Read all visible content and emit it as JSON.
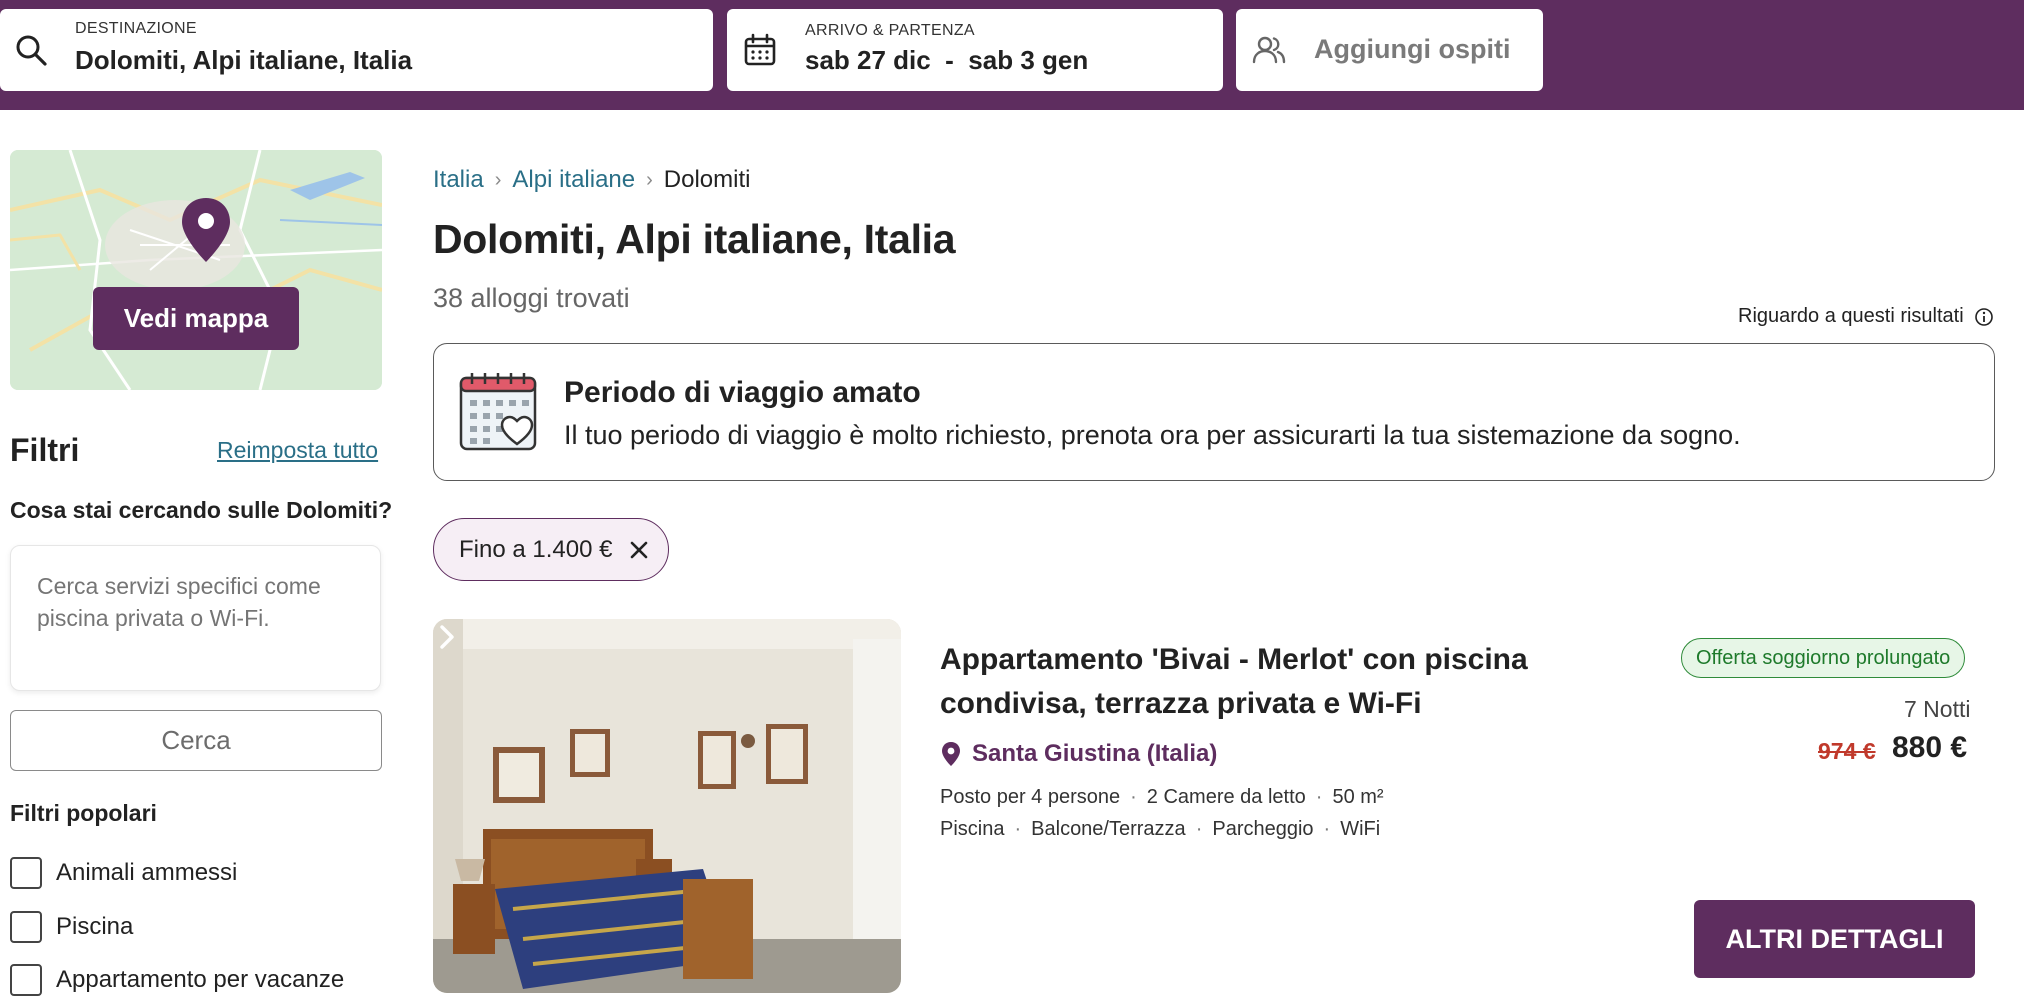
{
  "header": {
    "destination": {
      "label": "DESTINAZIONE",
      "value": "Dolomiti, Alpi italiane, Italia",
      "icon": "search-icon"
    },
    "dates": {
      "label": "ARRIVO & PARTENZA",
      "value": "sab 27 dic  -  sab 3 gen",
      "icon": "calendar-icon"
    },
    "guests": {
      "label": "Aggiungi ospiti",
      "icon": "guests-icon"
    }
  },
  "sidebar": {
    "map_button": "Vedi mappa",
    "filters_title": "Filtri",
    "reset_link": "Reimposta tutto",
    "search_question": "Cosa stai cercando sulle Dolomiti?",
    "search_placeholder": "Cerca servizi specifici come piscina privata o Wi-Fi.",
    "search_button": "Cerca",
    "popular_title": "Filtri popolari",
    "popular_filters": [
      {
        "label": "Animali ammessi",
        "checked": false
      },
      {
        "label": "Piscina",
        "checked": false
      },
      {
        "label": "Appartamento per vacanze",
        "checked": false
      }
    ]
  },
  "main": {
    "breadcrumb": [
      {
        "label": "Italia"
      },
      {
        "label": "Alpi italiane"
      },
      {
        "label": "Dolomiti"
      }
    ],
    "title": "Dolomiti, Alpi italiane, Italia",
    "results_count": "38 alloggi trovati",
    "about_results": "Riguardo a questi risultati",
    "banner": {
      "title": "Periodo di viaggio amato",
      "text": "Il tuo periodo di viaggio è molto richiesto, prenota ora per assicurarti la tua sistemazione da sogno."
    },
    "active_filter": "Fino a 1.400 €",
    "listing": {
      "title": "Appartamento 'Bivai - Merlot' con piscina condivisa, terrazza privata e Wi-Fi",
      "badge": "Offerta soggiorno prolungato",
      "location": "Santa Giustina (Italia)",
      "nights": "7 Notti",
      "old_price": "974 €",
      "price": "880 €",
      "features_line1": [
        "Posto per 4 persone",
        "2 Camere da letto",
        "50 m²"
      ],
      "features_line2": [
        "Piscina",
        "Balcone/Terrazza",
        "Parcheggio",
        "WiFi"
      ],
      "details_button": "ALTRI DETTAGLI"
    }
  },
  "colors": {
    "brand": "#5e2d5f",
    "link": "#2a6f87",
    "offer_green": "#1e7a2b",
    "old_price_red": "#c0392b"
  }
}
